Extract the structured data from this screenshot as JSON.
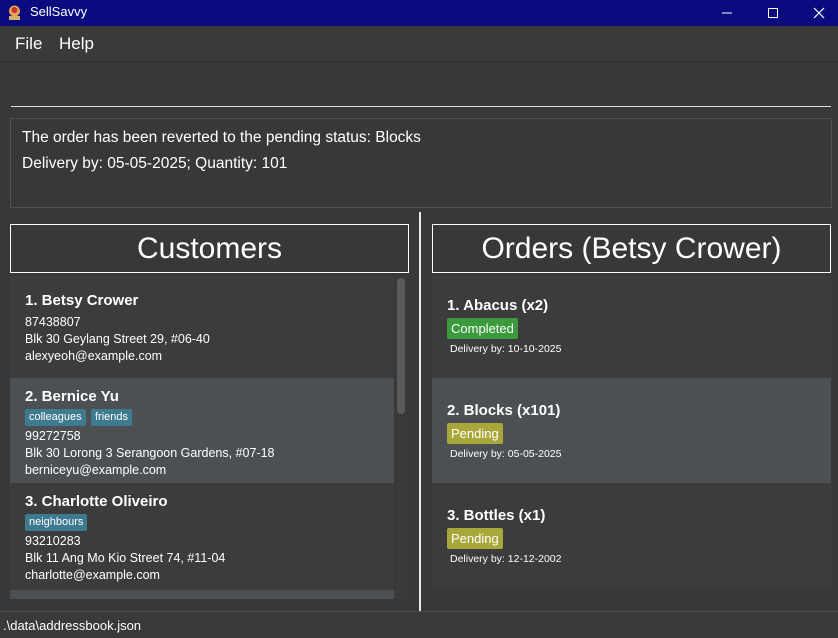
{
  "window": {
    "title": "SellSavvy",
    "minimize_icon": "minimize-icon",
    "maximize_icon": "maximize-icon",
    "close_icon": "close-icon"
  },
  "menu": {
    "file": "File",
    "help": "Help"
  },
  "command": {
    "value": "",
    "placeholder": ""
  },
  "result": {
    "line1": "The order has been reverted to the pending status: Blocks",
    "line2": "Delivery by: 05-05-2025; Quantity: 101"
  },
  "customers": {
    "title": "Customers",
    "items": [
      {
        "name": "1. Betsy Crower",
        "tags": [],
        "phone": "87438807",
        "address": "Blk 30 Geylang Street 29, #06-40",
        "email": "alexyeoh@example.com"
      },
      {
        "name": "2. Bernice Yu",
        "tags": [
          "colleagues",
          "friends"
        ],
        "phone": "99272758",
        "address": "Blk 30 Lorong 3 Serangoon Gardens, #07-18",
        "email": "berniceyu@example.com"
      },
      {
        "name": "3. Charlotte Oliveiro",
        "tags": [
          "neighbours"
        ],
        "phone": "93210283",
        "address": "Blk 11 Ang Mo Kio Street 74, #11-04",
        "email": "charlotte@example.com"
      }
    ]
  },
  "orders": {
    "title": "Orders (Betsy Crower)",
    "items": [
      {
        "name": "1. Abacus (x2)",
        "status": "Completed",
        "delivery": "Delivery by: 10-10-2025"
      },
      {
        "name": "2. Blocks (x101)",
        "status": "Pending",
        "delivery": "Delivery by: 05-05-2025"
      },
      {
        "name": "3. Bottles (x1)",
        "status": "Pending",
        "delivery": "Delivery by: 12-12-2002"
      }
    ]
  },
  "colors": {
    "titlebar": "#0b0b80",
    "tag": "#3e7b91",
    "completed": "#3a9a3c",
    "pending": "#a8a83a"
  },
  "statusbar": {
    "path": ".\\data\\addressbook.json"
  }
}
